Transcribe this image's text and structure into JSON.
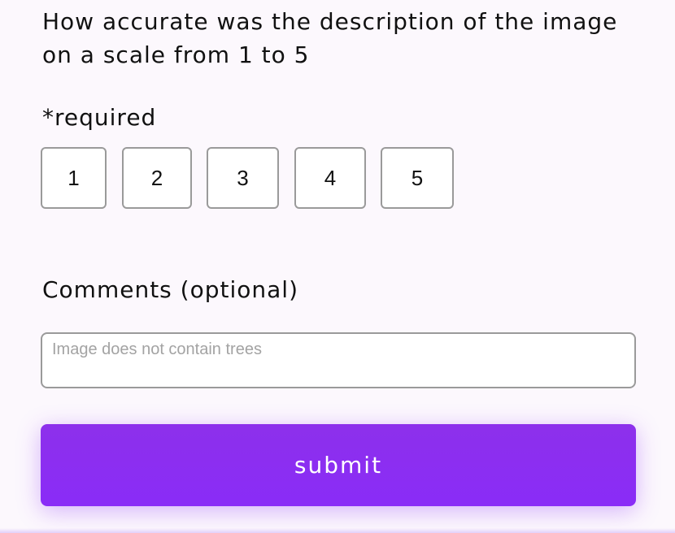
{
  "question": {
    "text": "How accurate was the description of the image on a scale from 1 to 5"
  },
  "required_label": "*required",
  "rating": {
    "options": [
      "1",
      "2",
      "3",
      "4",
      "5"
    ]
  },
  "comments": {
    "label": "Comments (optional)",
    "placeholder": "Image does not contain trees",
    "value": ""
  },
  "submit": {
    "label": "submit"
  },
  "colors": {
    "background": "#fcf8fd",
    "accent": "#8a2cf7",
    "border": "#9a9a9a"
  }
}
